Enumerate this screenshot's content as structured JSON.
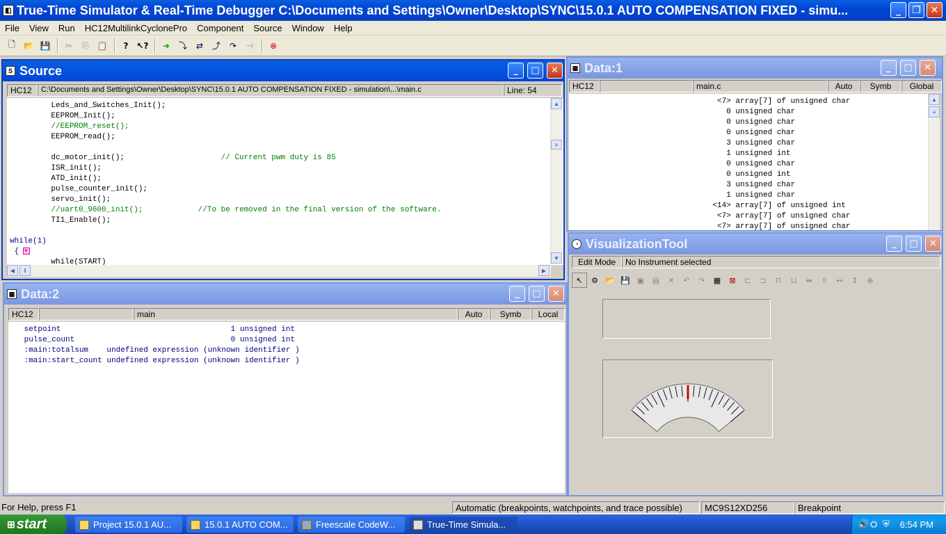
{
  "app": {
    "title": "True-Time Simulator & Real-Time Debugger   C:\\Documents and Settings\\Owner\\Desktop\\SYNC\\15.0.1 AUTO COMPENSATION FIXED - simu..."
  },
  "menu": [
    "File",
    "View",
    "Run",
    "HC12MultilinkCyclonePro",
    "Component",
    "Source",
    "Window",
    "Help"
  ],
  "toolbar": {
    "icons": [
      "new-icon",
      "open-icon",
      "save-icon",
      "cut-icon",
      "copy-icon",
      "paste-icon",
      "help-icon",
      "context-help-icon",
      "start-icon",
      "single-step-icon",
      "step-over-icon",
      "step-out-icon",
      "assembly-step-icon",
      "halt-icon",
      "reset-icon"
    ]
  },
  "source": {
    "title": "Source",
    "cpu": "HC12",
    "path": "C:\\Documents and Settings\\Owner\\Desktop\\SYNC\\15.0.1 AUTO COMPENSATION FIXED - simulation\\...\\main.c",
    "line_label": "Line: 54",
    "lines": [
      {
        "code": "         Leds_and_Switches_Init();",
        "comment": ""
      },
      {
        "code": "         EEPROM_Init();",
        "comment": ""
      },
      {
        "code": "         ",
        "comment": "//EEPROM_reset();"
      },
      {
        "code": "         EEPROM_read();",
        "comment": ""
      },
      {
        "code": "",
        "comment": ""
      },
      {
        "code": "         dc_motor_init();                     ",
        "comment": "// Current pwm duty is 85"
      },
      {
        "code": "         ISR_init();",
        "comment": ""
      },
      {
        "code": "         ATD_init();",
        "comment": ""
      },
      {
        "code": "         pulse_counter_init();",
        "comment": ""
      },
      {
        "code": "         servo_init();",
        "comment": ""
      },
      {
        "code": "         ",
        "comment": "//uart0_9600_init();            //To be removed in the final version of the software."
      },
      {
        "code": "         TI1_Enable();",
        "comment": ""
      },
      {
        "code": "",
        "comment": ""
      },
      {
        "code": "while(1)",
        "comment": ""
      },
      {
        "code": " {",
        "comment": ""
      },
      {
        "code": "         while(START)",
        "comment": ""
      }
    ]
  },
  "data1": {
    "title": "Data:1",
    "cpu": "HC12",
    "module": "main.c",
    "mode": "Auto",
    "format": "Symb",
    "scope": "Global",
    "rows": [
      "     <7> array[7] of unsigned char",
      "       0 unsigned char",
      "       0 unsigned char",
      "       0 unsigned char",
      "       3 unsigned char",
      "       1 unsigned int",
      "       0 unsigned char",
      "       0 unsigned int",
      "       3 unsigned char",
      "       1 unsigned char",
      "    <14> array[7] of unsigned int",
      "     <7> array[7] of unsigned char",
      "     <7> array[7] of unsigned char"
    ]
  },
  "data2": {
    "title": "Data:2",
    "cpu": "HC12",
    "module": "main",
    "mode": "Auto",
    "format": "Symb",
    "scope": "Local",
    "rows": [
      " setpoint                                     1 unsigned int",
      " pulse_count                                  0 unsigned int",
      " :main:totalsum    undefined expression (unknown identifier )",
      " :main:start_count undefined expression (unknown identifier )"
    ]
  },
  "viz": {
    "title": "VisualizationTool",
    "edit_mode": "Edit Mode",
    "instrument": "No Instrument selected",
    "gauge_value": 0.5
  },
  "status": {
    "help": "For Help, press F1",
    "mode": "Automatic (breakpoints, watchpoints, and trace possible)",
    "chip": "MC9S12XD256",
    "state": "Breakpoint"
  },
  "taskbar": {
    "start": "start",
    "tasks": [
      "Project 15.0.1 AU...",
      "15.0.1 AUTO COM...",
      "Freescale CodeW...",
      "True-Time Simula..."
    ],
    "clock": "6:54 PM"
  },
  "colors": {
    "titlebar": "#0046d5",
    "comment": "#008000",
    "keyword": "#000080"
  }
}
